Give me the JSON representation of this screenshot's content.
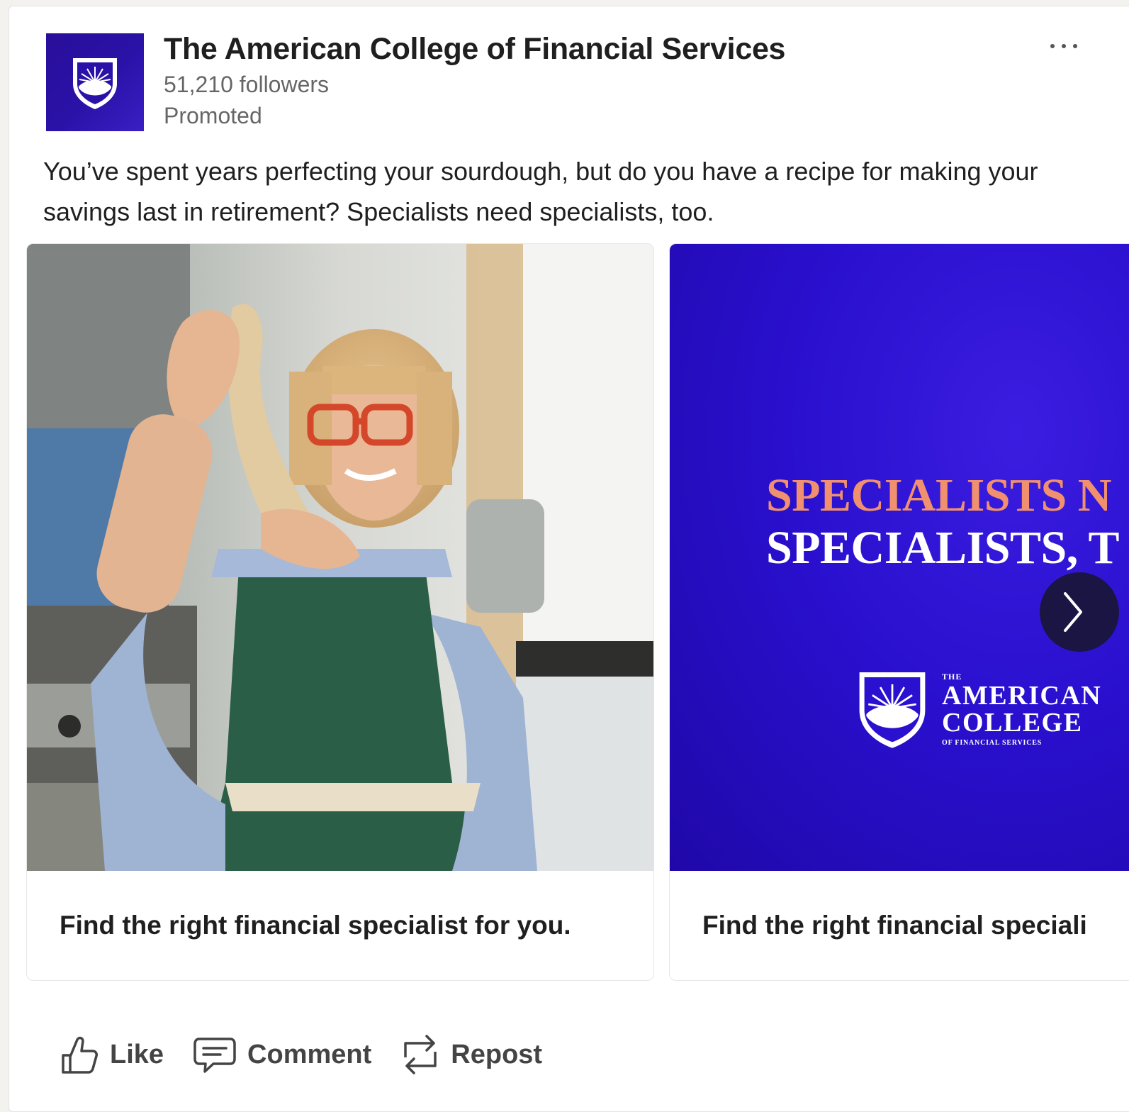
{
  "post": {
    "company_name": "The American College of Financial Services",
    "followers": "51,210 followers",
    "promoted": "Promoted",
    "menu_icon": "ellipsis-icon",
    "text": "You’ve spent years perfecting your sourdough, but do you have a recipe for making your savings last in retirement? Specialists need specialists, too."
  },
  "carousel": {
    "cards": [
      {
        "caption": "Find the right financial specialist for you.",
        "media": "photo-woman-kneading-dough"
      },
      {
        "caption": "Find the right financial speciali",
        "headline_line1": "SPECIALISTS N",
        "headline_line2": "SPECIALISTS, T",
        "lockup_the": "THE",
        "lockup_american": "AMERICAN",
        "lockup_college": "COLLEGE",
        "lockup_sub": "OF FINANCIAL SERVICES"
      }
    ],
    "next_icon": "chevron-right-icon"
  },
  "actions": {
    "like": "Like",
    "comment": "Comment",
    "repost": "Repost"
  },
  "colors": {
    "brand_purple": "#2a10cf",
    "headline_coral": "#f0906f",
    "text_dark": "#1f1f1f",
    "text_muted": "#666666"
  }
}
